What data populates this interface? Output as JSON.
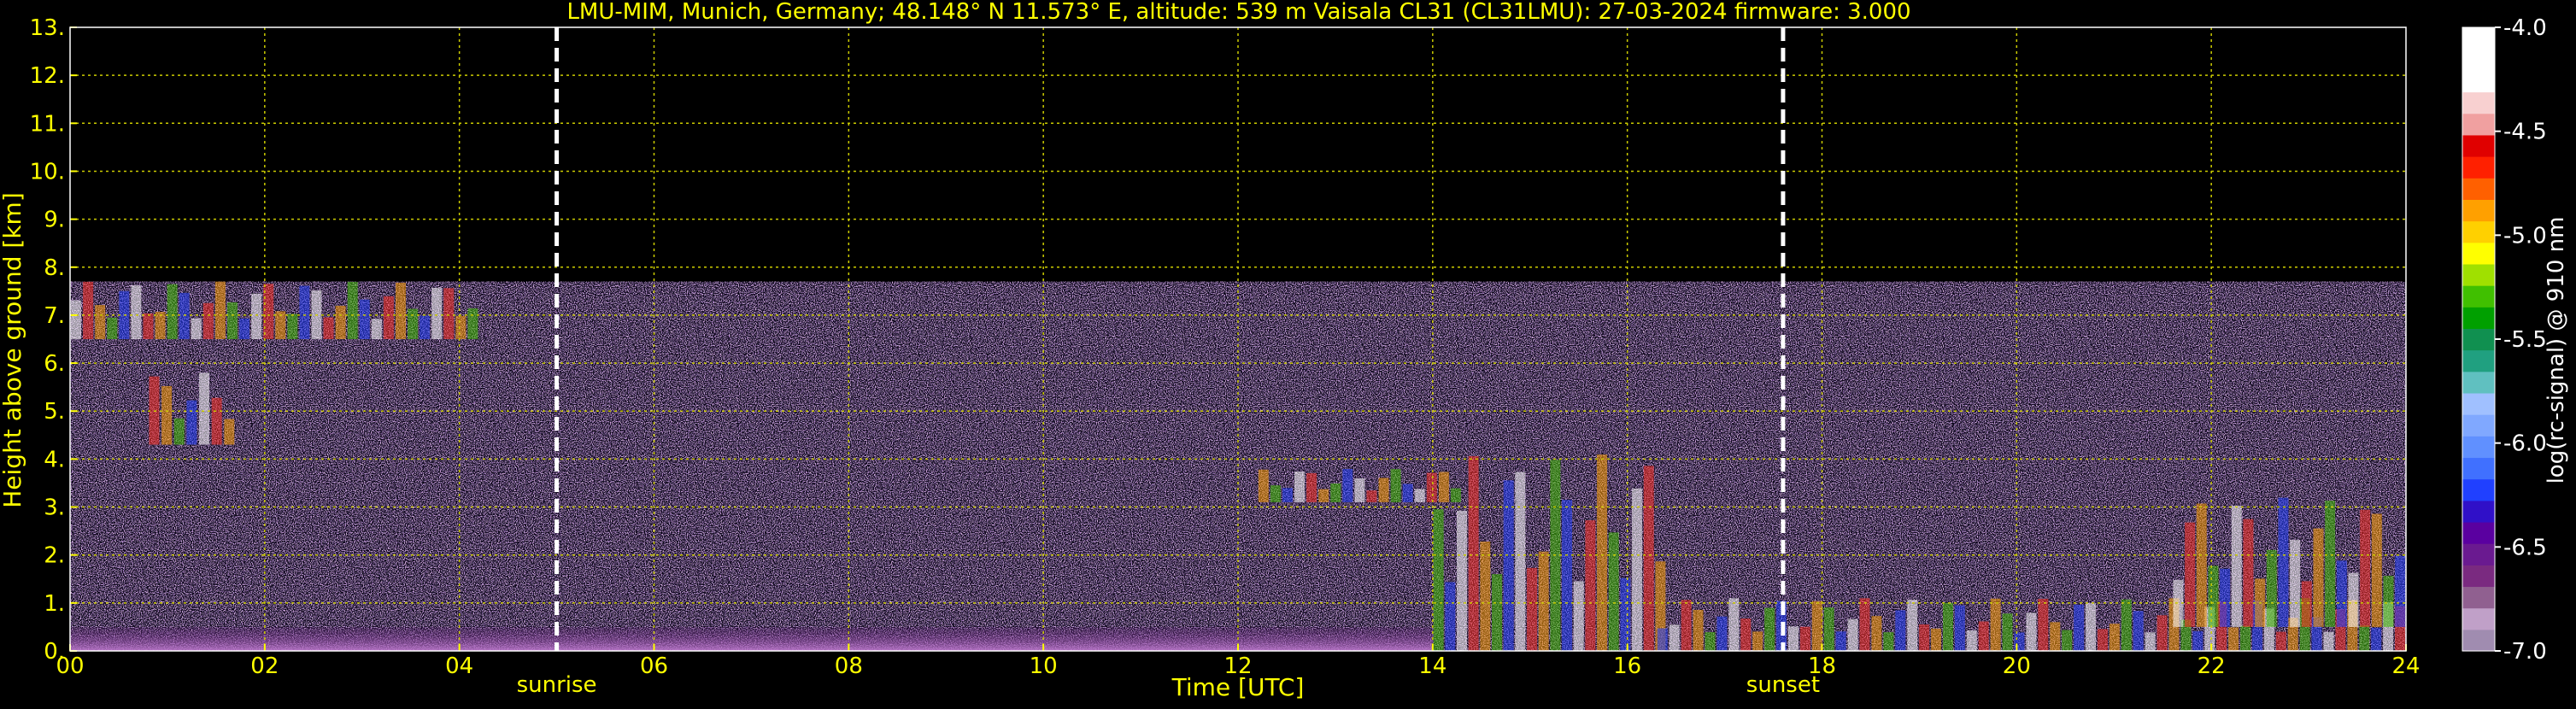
{
  "title": "LMU-MIM, Munich, Germany; 48.148° N 11.573° E, altitude: 539 m    Vaisala CL31 (CL31LMU): 27-03-2024    firmware: 3.000",
  "colors": {
    "background": "#000000",
    "text_yellow": "#ffff00",
    "grid_yellow": "#cccc00",
    "sun_line": "#ffffff"
  },
  "chart_data": {
    "type": "heatmap",
    "title": "LMU-MIM, Munich, Germany; 48.148° N 11.573° E, altitude: 539 m    Vaisala CL31 (CL31LMU): 27-03-2024    firmware: 3.000",
    "xlabel": "Time [UTC]",
    "ylabel": "Height above ground [km]",
    "xlim": [
      0,
      24
    ],
    "ylim": [
      0,
      13
    ],
    "x_ticks": [
      "00",
      "02",
      "04",
      "06",
      "08",
      "10",
      "12",
      "14",
      "16",
      "18",
      "20",
      "22",
      "24"
    ],
    "y_ticks": [
      "0.",
      "1.",
      "2.",
      "3.",
      "4.",
      "5.",
      "6.",
      "7.",
      "8.",
      "9.",
      "10.",
      "11.",
      "12.",
      "13."
    ],
    "grid": true,
    "sun_events": [
      {
        "label": "sunrise",
        "time_utc": 5.0
      },
      {
        "label": "sunset",
        "time_utc": 17.6
      }
    ],
    "data_top_km": 7.7,
    "colorbar": {
      "label": "log(rc-signal) @ 910 nm",
      "range": [
        -7.0,
        -4.0
      ],
      "ticks": [
        "-4.0",
        "-4.5",
        "-5.0",
        "-5.5",
        "-6.0",
        "-6.5",
        "-7.0"
      ],
      "colors": [
        "#a08cb0",
        "#c0a0c8",
        "#906090",
        "#7a2a80",
        "#6a1a90",
        "#5a00a0",
        "#3010c8",
        "#2040ff",
        "#4070ff",
        "#6090ff",
        "#80a8ff",
        "#a0c0ff",
        "#60c0c0",
        "#20a080",
        "#109050",
        "#00a000",
        "#40c000",
        "#a0e000",
        "#ffff00",
        "#ffd000",
        "#ffa000",
        "#ff6000",
        "#ff2000",
        "#e00000",
        "#f0a0a0",
        "#f8d0d0",
        "#ffffff",
        "#ffffff",
        "#ffffff"
      ]
    },
    "features": [
      {
        "name": "early cloud patches",
        "t_start": 0.0,
        "t_end": 4.2,
        "h_bottom": 6.5,
        "h_top": 7.7
      },
      {
        "name": "descending aerosol layer",
        "t_start": 0.8,
        "t_end": 1.7,
        "h_bottom": 4.3,
        "h_top": 5.8
      },
      {
        "name": "cloud base line",
        "t_start": 12.2,
        "t_end": 14.3,
        "h_bottom": 3.1,
        "h_top": 3.8
      },
      {
        "name": "convective plume",
        "t_start": 14.0,
        "t_end": 16.4,
        "h_bottom": 0.0,
        "h_top": 4.1
      },
      {
        "name": "evening boundary layer",
        "t_start": 16.3,
        "t_end": 24.0,
        "h_bottom": 0.0,
        "h_top": 1.1
      },
      {
        "name": "late aerosol layer",
        "t_start": 21.6,
        "t_end": 24.0,
        "h_bottom": 0.5,
        "h_top": 3.2
      }
    ]
  }
}
